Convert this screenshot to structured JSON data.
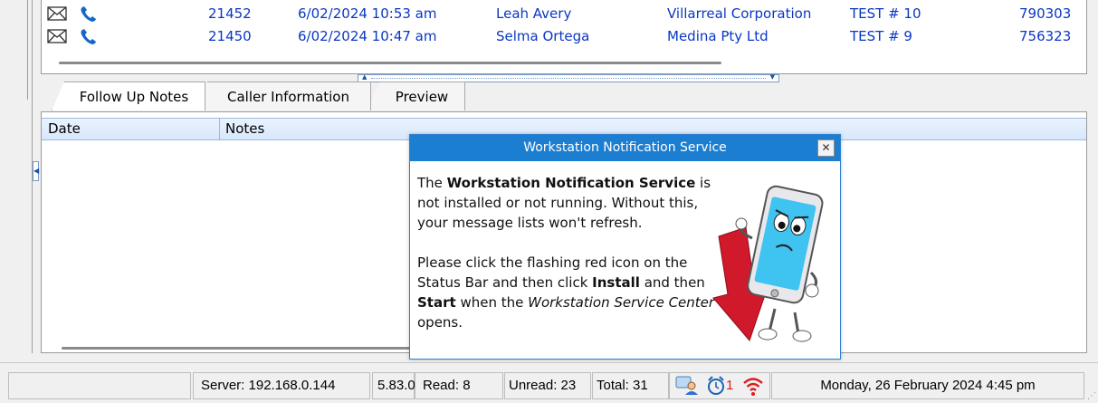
{
  "messages": [
    {
      "id": "21452",
      "date": "6/02/2024 10:53 am",
      "name": "Leah Avery",
      "company": "Villarreal Corporation",
      "test": "TEST # 10",
      "number": "790303"
    },
    {
      "id": "21450",
      "date": "6/02/2024 10:47 am",
      "name": "Selma Ortega",
      "company": "Medina Pty Ltd",
      "test": "TEST # 9",
      "number": "756323"
    }
  ],
  "tabs": {
    "follow_up": "Follow Up Notes",
    "caller_info": "Caller Information",
    "preview": "Preview"
  },
  "notes": {
    "col_date": "Date",
    "col_notes": "Notes"
  },
  "dialog": {
    "title": "Workstation Notification Service",
    "close": "✕",
    "p1_pre": "The ",
    "p1_bold": "Workstation Notification Service",
    "p1_post": " is not installed or not running.  Without this, your message lists won't refresh.",
    "p2_a": "Please click the flashing red icon on the Status Bar and then click ",
    "p2_install": "Install",
    "p2_b": " and then ",
    "p2_start": "Start",
    "p2_c": " when the ",
    "p2_italic": "Workstation Service Center",
    "p2_d": " opens."
  },
  "status_bar": {
    "server": "Server: 192.168.0.144",
    "version": "5.83.0",
    "read": "Read: 8",
    "unread": "Unread: 23",
    "total": "Total: 31",
    "alarm_count": "1",
    "datetime": "Monday, 26 February 2024  4:45 pm"
  },
  "colors": {
    "link_blue": "#0a37c4",
    "dialog_title_bg": "#1c7ed0",
    "alert_red": "#e0191e"
  }
}
